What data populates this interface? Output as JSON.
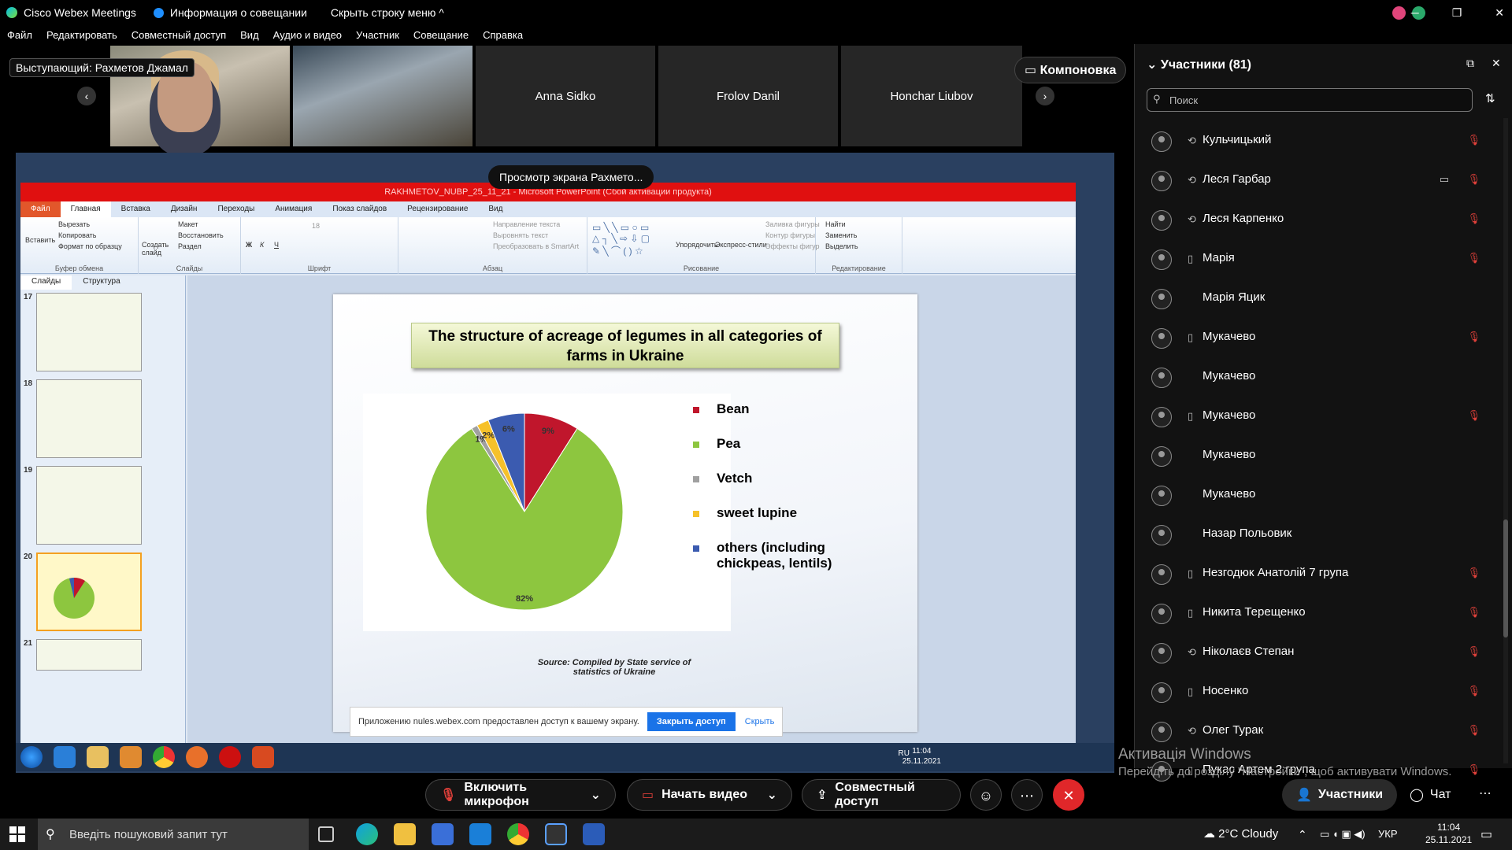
{
  "titlebar": {
    "app_title": "Cisco Webex Meetings",
    "meeting_info": "Информация о совещании",
    "hide_menu": "Скрыть строку меню ^"
  },
  "menu": [
    "Файл",
    "Редактировать",
    "Совместный доступ",
    "Вид",
    "Аудио и видео",
    "Участник",
    "Совещание",
    "Справка"
  ],
  "video_strip": {
    "presenter_label": "Выступающий: Рахметов Джамал",
    "tiles": [
      "Anna Sidko",
      "Frolov Danil",
      "Honchar Liubov"
    ],
    "layout_button": "Компоновка"
  },
  "share": {
    "toast": "Просмотр экрана Рахмето...",
    "ppt_title": "RAKHMETOV_NUBP_25_11_21 - Microsoft PowerPoint (Сбой активации продукта)",
    "ppt_tabs": [
      "Файл",
      "Главная",
      "Вставка",
      "Дизайн",
      "Переходы",
      "Анимация",
      "Показ слайдов",
      "Рецензирование",
      "Вид"
    ],
    "ribbon": {
      "groups": [
        "Буфер обмена",
        "Слайды",
        "Шрифт",
        "Абзац",
        "Рисование",
        "Редактирование"
      ],
      "paste": "Вставить",
      "cut": "Вырезать",
      "copy": "Копировать",
      "format": "Формат по образцу",
      "new_slide": "Создать слайд",
      "layout": "Макет",
      "reset": "Восстановить",
      "section": "Раздел",
      "text_dir": "Направление текста",
      "align_text": "Выровнять текст",
      "smartart": "Преобразовать в SmartArt",
      "arrange": "Упорядочить",
      "quick_styles": "Экспресс-стили",
      "fill": "Заливка фигуры",
      "outline": "Контур фигуры",
      "effects": "Эффекты фигур",
      "find": "Найти",
      "replace": "Заменить",
      "select": "Выделить",
      "font_size": "18"
    },
    "panel_tabs": [
      "Слайды",
      "Структура"
    ],
    "slide_numbers": [
      "17",
      "18",
      "19",
      "20",
      "21"
    ],
    "slide_title": "The structure of acreage of legumes in all categories of farms in Ukraine",
    "source": "Source: Compiled by State service of statistics of Ukraine",
    "notice": {
      "text": "Приложению nules.webex.com предоставлен доступ к вашему экрану.",
      "close": "Закрыть доступ",
      "hide": "Скрыть"
    },
    "inner_tray": {
      "lang": "RU",
      "time": "11:04",
      "date": "25.11.2021"
    }
  },
  "chart_data": {
    "type": "pie",
    "categories": [
      "Bean",
      "Pea",
      "Vetch",
      "sweet lupine",
      "others (including chickpeas, lentils)"
    ],
    "values": [
      9,
      82,
      1,
      2,
      6
    ],
    "labels": [
      "9%",
      "82%",
      "1%",
      "2%",
      "6%"
    ],
    "colors": [
      "#c0162c",
      "#8dc63f",
      "#a0a0a0",
      "#f6c12a",
      "#3b5bb0"
    ],
    "legend_position": "right"
  },
  "participants_panel": {
    "title": "Участники (81)",
    "search_placeholder": "Поиск",
    "items": [
      {
        "name": "Кульчицький",
        "device": "phone",
        "muted": true
      },
      {
        "name": "Леся Гарбар",
        "device": "phone",
        "muted": true,
        "camera": true
      },
      {
        "name": "Леся Карпенко",
        "device": "phone",
        "muted": true
      },
      {
        "name": "Марія",
        "device": "mobile",
        "muted": true
      },
      {
        "name": "Марія Яцик",
        "device": "",
        "muted": false
      },
      {
        "name": "Мукачево",
        "device": "mobile",
        "muted": true
      },
      {
        "name": "Мукачево",
        "device": "",
        "muted": false
      },
      {
        "name": "Мукачево",
        "device": "mobile",
        "muted": true
      },
      {
        "name": "Мукачево",
        "device": "",
        "muted": false
      },
      {
        "name": "Мукачево",
        "device": "",
        "muted": false
      },
      {
        "name": "Назар Польовик",
        "device": "",
        "muted": false
      },
      {
        "name": "Незгодюк Анатолій 7 група",
        "device": "mobile",
        "muted": true
      },
      {
        "name": "Никита Терещенко",
        "device": "mobile",
        "muted": true
      },
      {
        "name": "Ніколаєв Степан",
        "device": "phone",
        "muted": true
      },
      {
        "name": "Носенко",
        "device": "mobile",
        "muted": true
      },
      {
        "name": "Олег Турак",
        "device": "phone",
        "muted": true
      },
      {
        "name": "Пукас Артем 2 група",
        "device": "mobile",
        "muted": true
      }
    ]
  },
  "activation": {
    "line1": "Активація Windows",
    "line2": "Перейдіть до розділу \"Настройки\", щоб активувати Windows."
  },
  "controls": {
    "mic": "Включить микрофон",
    "video": "Начать видео",
    "share": "Совместный доступ",
    "participants": "Участники",
    "chat": "Чат"
  },
  "taskbar": {
    "search_placeholder": "Введіть пошуковий запит тут",
    "weather": "2°C  Cloudy",
    "lang": "УКР",
    "time": "11:04",
    "date": "25.11.2021"
  }
}
